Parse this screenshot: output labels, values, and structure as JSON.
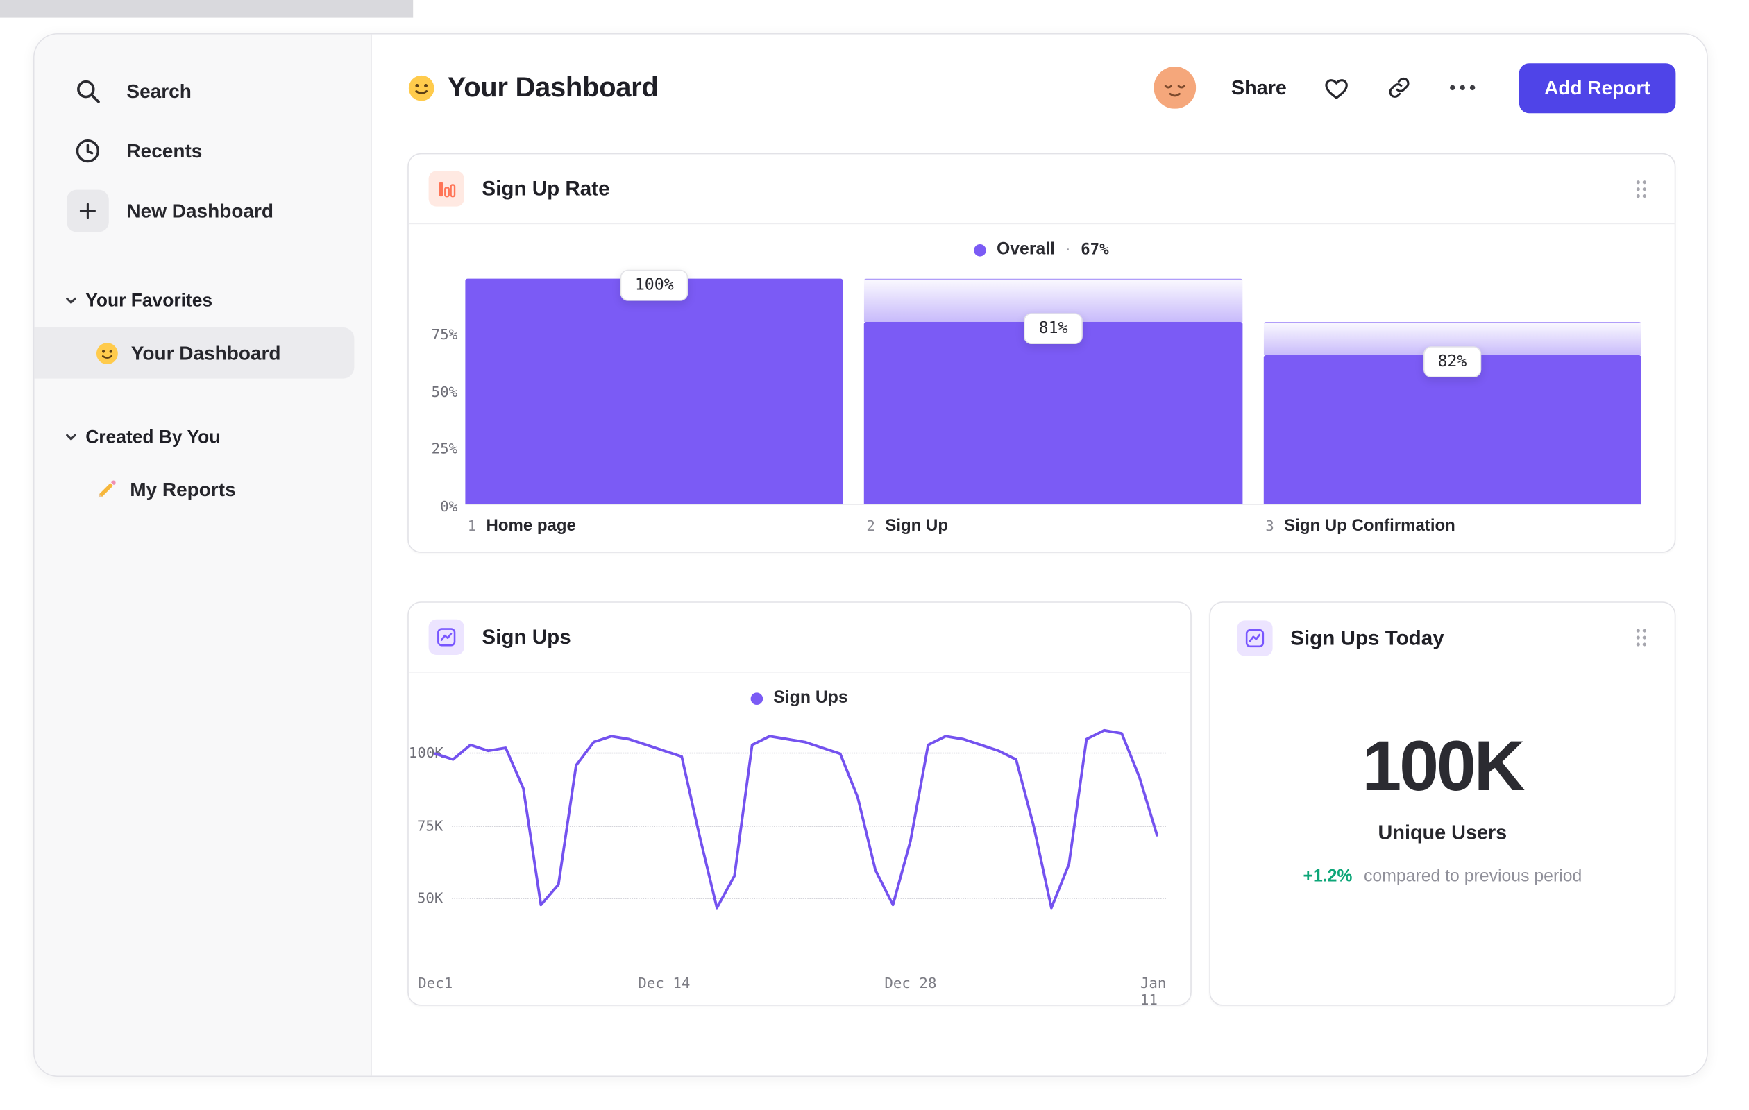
{
  "colors": {
    "accent_purple": "#7b5bf5",
    "button_purple": "#4f44e8",
    "icon_orange": "#ff7557",
    "positive_green": "#0da678",
    "sidebar_bg": "#f8f8f9"
  },
  "icons": {
    "sidebar": [
      "search-icon",
      "clock-icon",
      "plus-icon",
      "chevron-down-icon",
      "smiley-emoji-icon",
      "pencil-emoji-icon"
    ],
    "header": [
      "smiley-emoji-icon",
      "avatar-face-icon",
      "heart-icon",
      "link-icon",
      "more-options-icon"
    ],
    "cards": [
      "bar-chart-icon",
      "line-chart-icon",
      "drag-handle-icon"
    ]
  },
  "sidebar": {
    "items": [
      {
        "label": "Search"
      },
      {
        "label": "Recents"
      },
      {
        "label": "New Dashboard"
      }
    ],
    "sections": [
      {
        "label": "Your Favorites",
        "items": [
          {
            "label": "Your Dashboard",
            "selected": true
          }
        ]
      },
      {
        "label": "Created By You",
        "items": [
          {
            "label": "My Reports",
            "selected": false
          }
        ]
      }
    ]
  },
  "header": {
    "title": "Your Dashboard",
    "share_label": "Share",
    "add_report_label": "Add Report"
  },
  "chart_data": [
    {
      "type": "bar",
      "subtype": "funnel",
      "title": "Sign Up Rate",
      "legend": {
        "series": "Overall",
        "separator": "·",
        "overall_conversion": "67%"
      },
      "y_ticks": [
        "75%",
        "50%",
        "25%",
        "0%"
      ],
      "ylim": [
        0,
        100
      ],
      "bar_color": "#7b5bf5",
      "steps": [
        {
          "num": "1",
          "label": "Home page",
          "tooltip": "100%",
          "total_pct": 100,
          "solid_pct": 100
        },
        {
          "num": "2",
          "label": "Sign Up",
          "tooltip": "81%",
          "total_pct": 100,
          "solid_pct": 81
        },
        {
          "num": "3",
          "label": "Sign Up Confirmation",
          "tooltip": "82%",
          "total_pct": 81,
          "solid_pct": 66
        }
      ]
    },
    {
      "type": "line",
      "title": "Sign Ups",
      "legend": "Sign Ups",
      "color": "#7452ef",
      "unit": "K",
      "y_ticks": [
        {
          "label": "100K",
          "value": 100
        },
        {
          "label": "75K",
          "value": 75
        },
        {
          "label": "50K",
          "value": 50
        }
      ],
      "x_ticks": [
        {
          "label": "Dec1",
          "day": 0
        },
        {
          "label": "Dec 14",
          "day": 13
        },
        {
          "label": "Dec 28",
          "day": 27
        },
        {
          "label": "Jan 11",
          "day": 41
        }
      ],
      "values_by_day": [
        100,
        98,
        103,
        101,
        102,
        88,
        48,
        55,
        96,
        104,
        106,
        105,
        103,
        101,
        99,
        72,
        47,
        58,
        103,
        106,
        105,
        104,
        102,
        100,
        85,
        60,
        48,
        70,
        103,
        106,
        105,
        103,
        101,
        98,
        75,
        47,
        62,
        105,
        108,
        107,
        92,
        72
      ]
    },
    {
      "type": "stat",
      "title": "Sign Ups Today",
      "value": "100K",
      "label": "Unique Users",
      "delta": "+1.2%",
      "delta_direction": "up",
      "note": "compared to previous period"
    }
  ]
}
